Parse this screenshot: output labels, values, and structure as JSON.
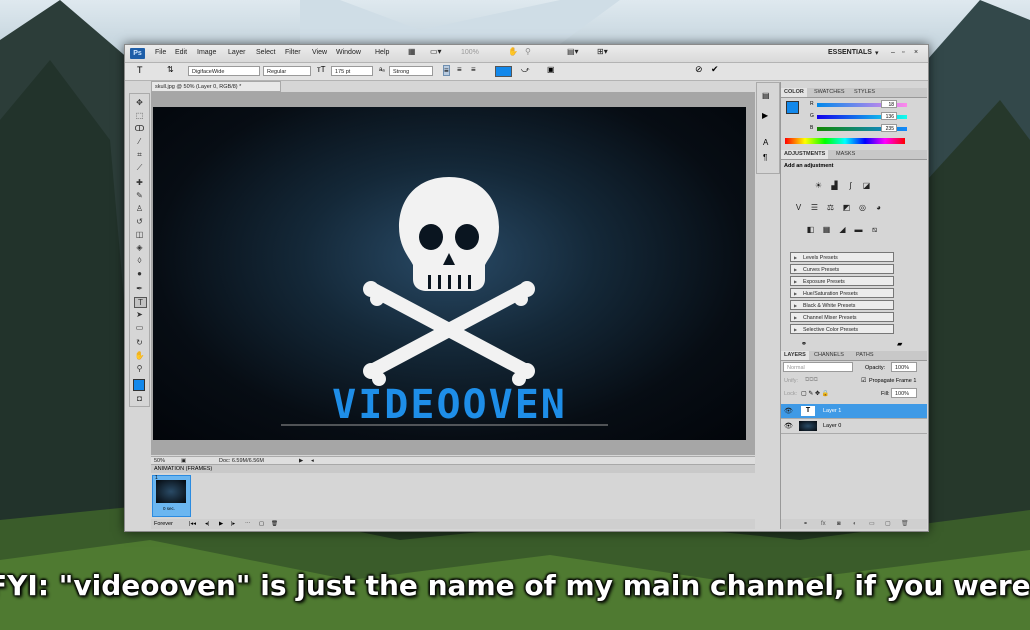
{
  "app": {
    "logo": "Ps",
    "workspace": "ESSENTIALS"
  },
  "menu": [
    "File",
    "Edit",
    "Image",
    "Layer",
    "Select",
    "Filter",
    "View",
    "Window",
    "Help"
  ],
  "options": {
    "font_family": "DigifaceWide",
    "font_style": "Regular",
    "font_size": "175 pt",
    "aa_label": "aₐ",
    "antialias": "Strong",
    "zoom_pct": "100%"
  },
  "document": {
    "tab_title": "skull.jpg @ 50% (Layer 0, RGB/8) *",
    "wordmark": "VIDEOOVEN",
    "zoom": "50%",
    "doc_size": "Doc: 6.59M/6.56M"
  },
  "animation": {
    "title": "ANIMATION (FRAMES)",
    "frame_number": "1",
    "frame_delay": "0 sec.",
    "loop": "Forever"
  },
  "color_panel": {
    "tabs": [
      "COLOR",
      "SWATCHES",
      "STYLES"
    ],
    "r": "18",
    "g": "136",
    "b": "235",
    "fg_color": "#1288eb"
  },
  "adjustments": {
    "tabs": [
      "ADJUSTMENTS",
      "MASKS"
    ],
    "heading": "Add an adjustment",
    "presets": [
      "Levels Presets",
      "Curves Presets",
      "Exposure Presets",
      "Hue/Saturation Presets",
      "Black & White Presets",
      "Channel Mixer Presets",
      "Selective Color Presets"
    ]
  },
  "layers": {
    "tabs": [
      "LAYERS",
      "CHANNELS",
      "PATHS"
    ],
    "blend_mode": "Normal",
    "opacity_label": "Opacity:",
    "opacity": "100%",
    "unify_label": "Unify:",
    "propagate": "Propagate Frame 1",
    "lock_label": "Lock:",
    "fill_label": "Fill:",
    "fill": "100%",
    "items": [
      {
        "name": "Layer 1",
        "selected": true
      },
      {
        "name": "Layer 0",
        "selected": false
      }
    ]
  },
  "subtitle": "FYI: \"videooven\" is just the name of my main channel, if you were curious"
}
